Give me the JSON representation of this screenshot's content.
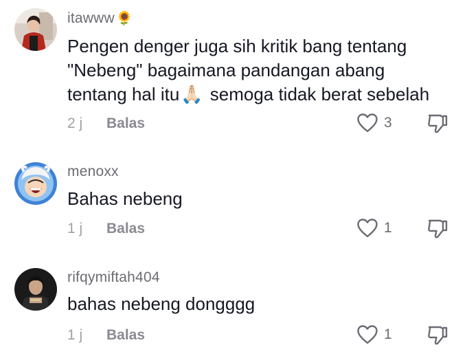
{
  "comments": [
    {
      "username": "itawww",
      "username_emoji": "🌻",
      "avatar_icon": "user-photo-avatar",
      "text_lines": [
        "Pengen denger juga sih kritik bang tentang",
        "\"Nebeng\" bagaimana pandangan abang",
        "tentang hal itu",
        "semoga tidak berat sebelah"
      ],
      "inline_emoji": "🙏🏻",
      "time": "2 j",
      "reply_label": "Balas",
      "likes": "3"
    },
    {
      "username": "menoxx",
      "avatar_icon": "anime-character-avatar",
      "text_lines": [
        "Bahas nebeng"
      ],
      "time": "1 j",
      "reply_label": "Balas",
      "likes": "1"
    },
    {
      "username": "rifqymiftah404",
      "avatar_icon": "user-photo-avatar",
      "text_lines": [
        "bahas nebeng dongggg"
      ],
      "time": "1 j",
      "reply_label": "Balas",
      "likes": "1"
    }
  ],
  "colors": {
    "text": "#161823",
    "username": "#6b6b73",
    "secondary": "#a0a0a6",
    "icon": "#6b6b73"
  },
  "icons": {
    "like": "heart-outline-icon",
    "dislike": "thumbs-down-icon"
  }
}
